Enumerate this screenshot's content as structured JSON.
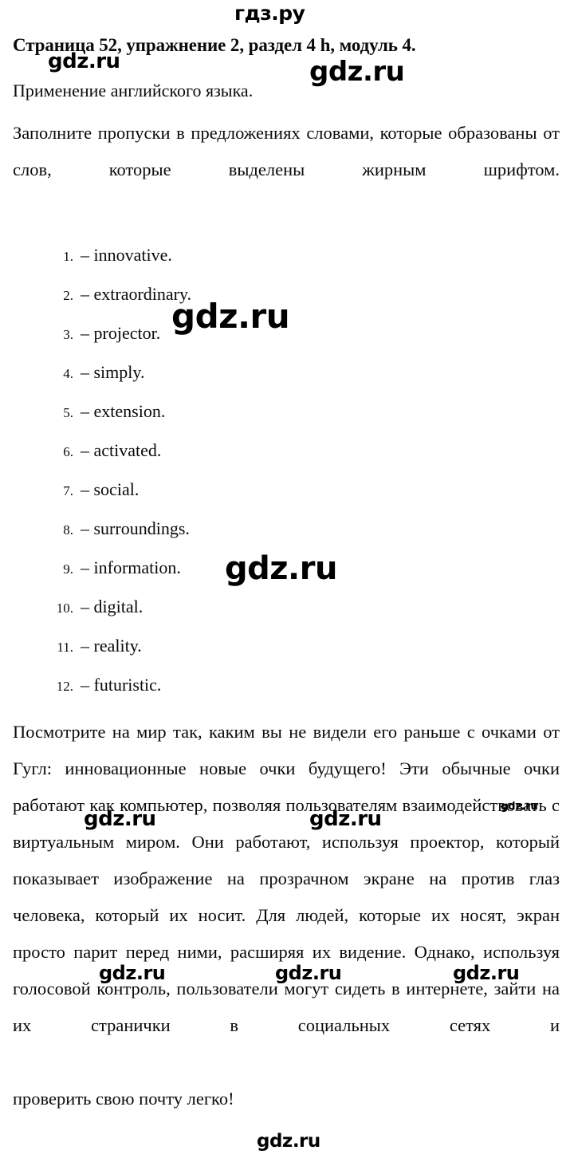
{
  "page": {
    "title": "Страница 52, упражнение 2, раздел 4 h, модуль 4.",
    "subtitle": "Применение английского языка.",
    "instructions": "Заполните пропуски в предложениях словами, которые образованы от слов, которые выделены жирным шрифтом."
  },
  "answers": [
    {
      "num": "1.",
      "text": "– innovative."
    },
    {
      "num": "2.",
      "text": "– extraordinary."
    },
    {
      "num": "3.",
      "text": "– projector."
    },
    {
      "num": "4.",
      "text": "– simply."
    },
    {
      "num": "5.",
      "text": "– extension."
    },
    {
      "num": "6.",
      "text": "– activated."
    },
    {
      "num": "7.",
      "text": "– social."
    },
    {
      "num": "8.",
      "text": "– surroundings."
    },
    {
      "num": "9.",
      "text": "– information."
    },
    {
      "num": "10.",
      "text": "– digital."
    },
    {
      "num": "11.",
      "text": "– reality."
    },
    {
      "num": "12.",
      "text": "– futuristic."
    }
  ],
  "translation": {
    "body": "Посмотрите на мир так, каким вы не видели его раньше с очками от Гугл: инновационные новые очки будущего! Эти обычные очки работают как компьютер, позволяя пользователям взаимодействовать с виртуальным миром. Они работают, используя проектор, который показывает изображение на прозрачном экране на против глаз человека, который их носит. Для людей, которые их носят, экран просто парит перед ними, расширяя их видение. Однако, используя голосовой контроль, пользователи могут сидеть в интернете, зайти на их странички в социальных сетях и",
    "last_line": "проверить свою почту легко!"
  },
  "watermarks": {
    "top": "гдз.ру",
    "a": "gdz.ru",
    "b": "gdz.ru",
    "c": "gdz.ru",
    "d": "gdz.ru",
    "e": "gdz.ru",
    "f": "gdz.ru",
    "g": "gdz.ru",
    "h": "gdz.ru",
    "i": "gdz.ru",
    "j": "gdz.ru",
    "bottom": "gdz.ru"
  },
  "colors": {
    "background": "#ffffff",
    "text": "#0a0a0a",
    "watermark": "#000000"
  }
}
